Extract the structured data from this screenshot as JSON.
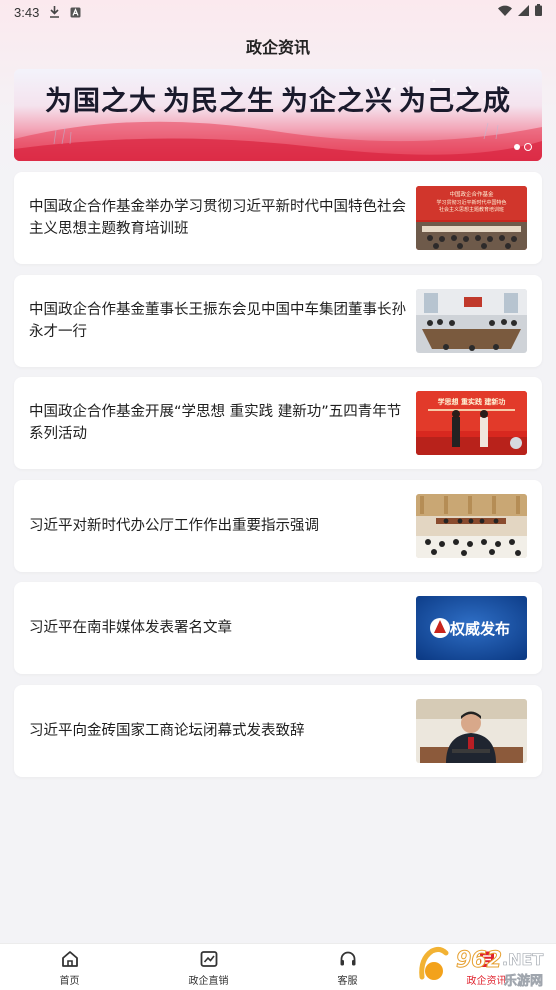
{
  "status_bar": {
    "time": "3:43",
    "icons_left": [
      "download-icon",
      "a-icon"
    ],
    "icons_right": [
      "wifi-icon",
      "signal-icon",
      "battery-icon"
    ]
  },
  "page_title": "政企资讯",
  "banner": {
    "slogan": [
      "为国之大",
      "为民之生",
      "为企之兴",
      "为己之成"
    ],
    "dots": 2,
    "active_dot": 1
  },
  "news": [
    {
      "title": "中国政企合作基金举办学习贯彻习近平新时代中国特色社会主义思想主题教育培训班",
      "thumb": "training-class-photo",
      "thumb_text": [
        "中国政企合作基金",
        "学习贯彻习近平新时代中国特色",
        "社会主义思想主题教育培训班"
      ]
    },
    {
      "title": "中国政企合作基金董事长王振东会见中国中车集团董事长孙永才一行",
      "thumb": "meeting-room-photo"
    },
    {
      "title": "中国政企合作基金开展“学思想 重实践 建新功”五四青年节系列活动",
      "thumb": "youth-day-stage-photo",
      "thumb_text": [
        "学思想 重实践 建新功"
      ]
    },
    {
      "title": "习近平对新时代办公厅工作作出重要指示强调",
      "thumb": "conference-hall-photo"
    },
    {
      "title": "习近平在南非媒体发表署名文章",
      "thumb": "authority-release-badge",
      "thumb_text": [
        "权威发布"
      ]
    },
    {
      "title": "习近平向金砖国家工商论坛闭幕式发表致辞",
      "thumb": "speaker-portrait-photo"
    }
  ],
  "bottom_nav": [
    {
      "label": "首页",
      "icon": "home-icon"
    },
    {
      "label": "政企直销",
      "icon": "chart-icon"
    },
    {
      "label": "客服",
      "icon": "headset-icon"
    },
    {
      "label": "政企资讯",
      "icon": "news-icon"
    }
  ],
  "active_tab": 3,
  "watermark": {
    "number": "962",
    "suffix": ".NET",
    "tagline": "乐游网"
  },
  "colors": {
    "accent": "#e0242f",
    "banner_red": "#e23a54"
  }
}
